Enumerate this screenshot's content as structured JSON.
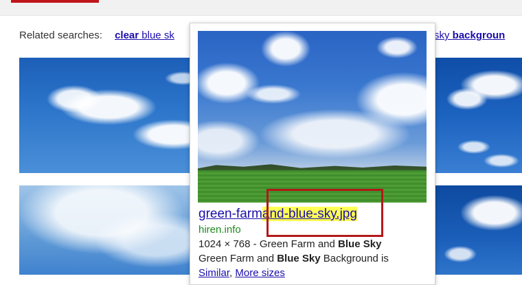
{
  "colors": {
    "link": "#1a0dab",
    "domain": "#1e8a1e",
    "highlight": "#ffff55",
    "annotation_box": "#b41818",
    "top_accent": "#c0141b"
  },
  "related_searches": {
    "label": "Related searches:",
    "left_link": {
      "bold": "clear",
      "rest": " blue sk"
    },
    "right_link": {
      "plain": " sky ",
      "bold": "backgroun"
    }
  },
  "popup": {
    "title_before_highlight": "green-farm",
    "title_highlighted": "and-blue-sky.jpg",
    "domain": "hiren.info",
    "meta_prefix": "1024 × 768 - Green Farm and ",
    "meta_bold": "Blue Sky",
    "desc_prefix": "Green Farm and ",
    "desc_bold": "Blue Sky",
    "desc_suffix": " Background is",
    "links": [
      "Similar",
      "More sizes"
    ]
  }
}
